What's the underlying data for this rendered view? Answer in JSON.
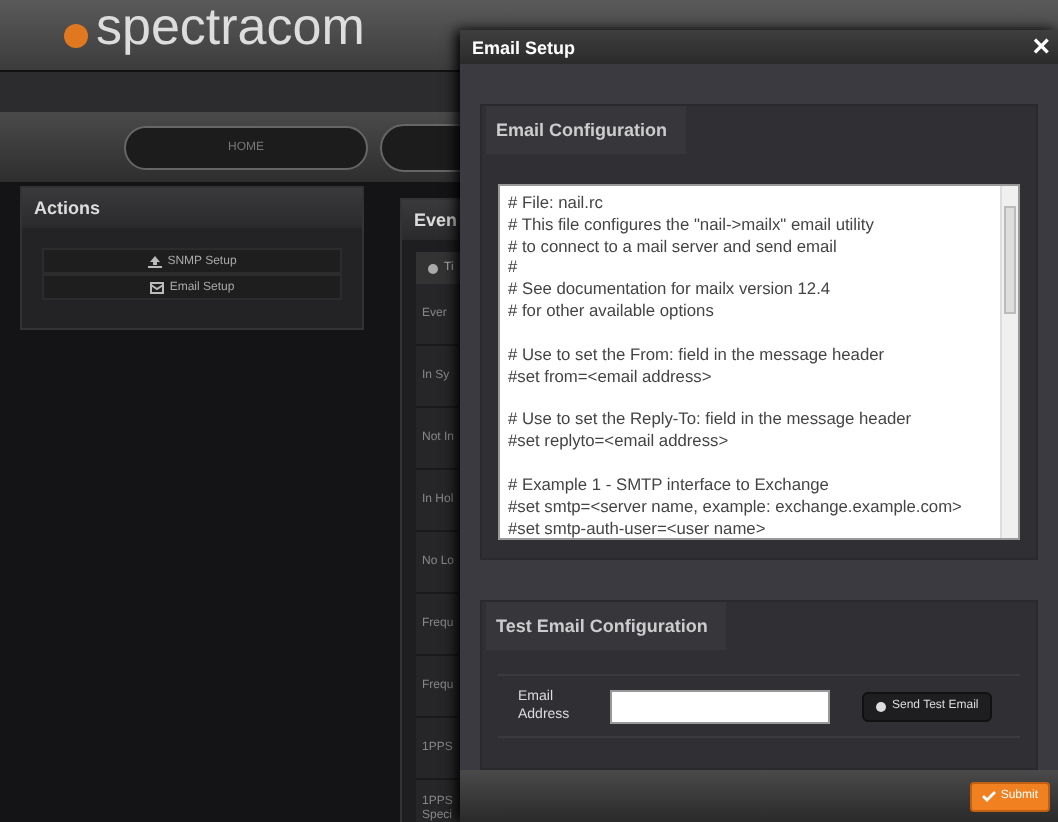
{
  "logo": {
    "text": "spectracom"
  },
  "nav": {
    "items": [
      {
        "label": "HOME"
      }
    ]
  },
  "actions": {
    "title": "Actions",
    "buttons": [
      {
        "label": "SNMP Setup",
        "kind": "snmp"
      },
      {
        "label": "Email Setup",
        "kind": "email"
      }
    ]
  },
  "events": {
    "title": "Even",
    "tab": "Ti",
    "rows": [
      "Ever",
      "In Sy",
      "Not In",
      "In Hol",
      "No Lo",
      "Frequ",
      "Frequ",
      "1PPS",
      "1PPS Speci"
    ]
  },
  "dialog": {
    "title": "Email Setup",
    "close": "×",
    "config": {
      "title": "Email Configuration",
      "paragraphs": [
        [
          "# File: nail.rc",
          "# This file configures the \"nail->mailx\" email utility",
          "# to connect to a mail server and send email",
          "#",
          "# See documentation for mailx version 12.4",
          "# for other available options"
        ],
        [
          "# Use to set the From: field in the message header",
          "#set from=<email address>"
        ],
        [
          "# Use to set the Reply-To: field in the message header",
          "#set replyto=<email address>"
        ],
        [
          "# Example 1 - SMTP interface to Exchange",
          "#set smtp=<server name, example: exchange.example.com>",
          "#set smtp-auth-user=<user name>"
        ]
      ]
    },
    "test": {
      "title": "Test Email Configuration",
      "field_label": "Email Address",
      "send_button": "Send Test Email"
    },
    "submit": "Submit"
  }
}
